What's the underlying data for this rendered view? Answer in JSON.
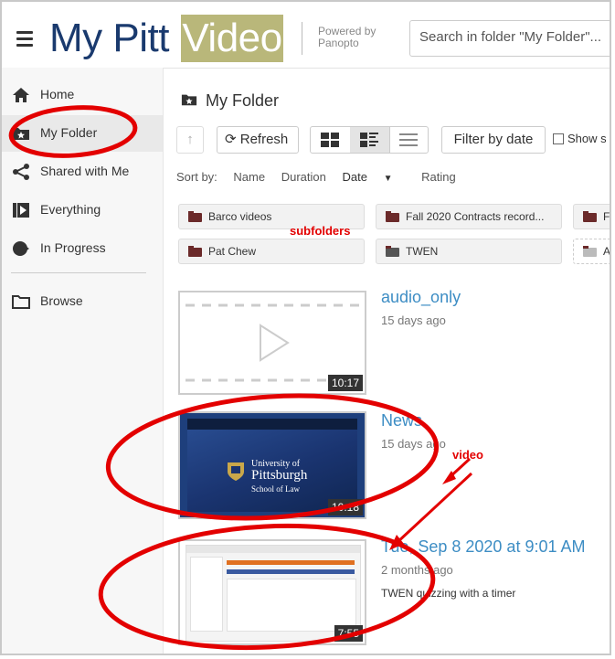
{
  "header": {
    "logo_text": "My Pitt",
    "logo_box_text": "Video",
    "powered_line1": "Powered by",
    "powered_line2": "Panopto",
    "search_text": "Search in folder \"My Folder\"..."
  },
  "sidebar": {
    "items": [
      {
        "label": "Home",
        "icon": "home-icon"
      },
      {
        "label": "My Folder",
        "icon": "folder-star-icon"
      },
      {
        "label": "Shared with Me",
        "icon": "share-icon"
      },
      {
        "label": "Everything",
        "icon": "play-box-icon"
      },
      {
        "label": "In Progress",
        "icon": "progress-icon"
      },
      {
        "label": "Browse",
        "icon": "folder-outline-icon"
      }
    ]
  },
  "main": {
    "title": "My Folder",
    "toolbar": {
      "refresh_label": "Refresh",
      "filter_label": "Filter by date",
      "show_label": "Show s"
    },
    "sort": {
      "label": "Sort by:",
      "options": [
        "Name",
        "Duration",
        "Date",
        "Rating"
      ],
      "active": "Date"
    },
    "folders": [
      {
        "name": "Barco videos"
      },
      {
        "name": "Fall 2020 Contracts record..."
      },
      {
        "name": "F"
      },
      {
        "name": "Pat Chew"
      },
      {
        "name": "TWEN"
      },
      {
        "name": "A"
      }
    ],
    "sessions": [
      {
        "title": "audio_only",
        "age": "15 days ago",
        "duration": "10:17",
        "description": ""
      },
      {
        "title": "News",
        "age": "15 days ago",
        "duration": "10:18",
        "description": "",
        "thumb_text_1": "University of",
        "thumb_text_2": "Pittsburgh",
        "thumb_text_3": "School of Law"
      },
      {
        "title": "Tue, Sep 8 2020 at 9:01 AM",
        "age": "2 months ago",
        "duration": "7:55",
        "description": "TWEN quizzing with a timer"
      }
    ]
  },
  "annotations": {
    "subfolders": "subfolders",
    "video": "video",
    "color": "#e30000"
  }
}
